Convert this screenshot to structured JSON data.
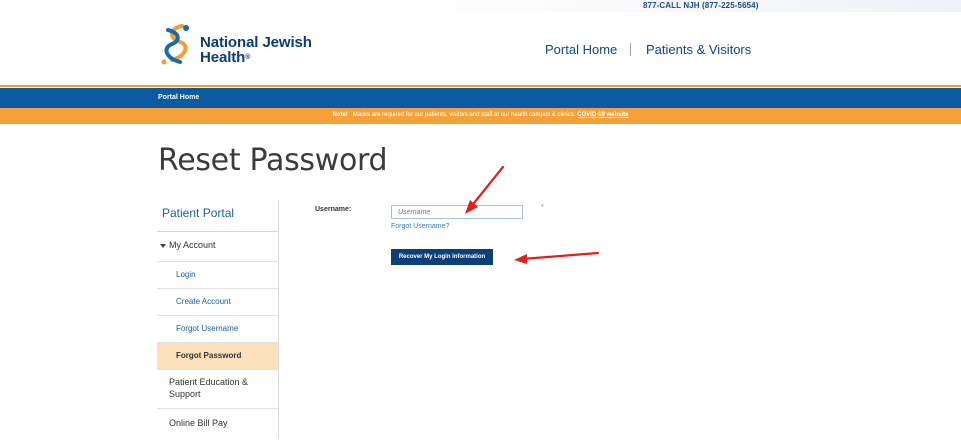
{
  "header": {
    "phone": "877-CALL NJH (877-225-5654)",
    "logo_line1": "National Jewish",
    "logo_line2": "Health",
    "logo_reg": "®",
    "nav": [
      {
        "label": "Portal Home"
      },
      {
        "label": "Patients & Visitors"
      }
    ]
  },
  "breadcrumb": "Portal Home",
  "notice": {
    "prefix": "Note!",
    "text": "Masks are required for our patients, visitors and staff at our health campus & clinics.",
    "link": "COVID-19 website"
  },
  "page_title": "Reset Password",
  "sidebar": {
    "heading": "Patient Portal",
    "my_account": "My Account",
    "sub_items": [
      {
        "label": "Login"
      },
      {
        "label": "Create Account"
      },
      {
        "label": "Forgot Username"
      },
      {
        "label": "Forgot Password"
      }
    ],
    "education": "Patient Education & Support",
    "bill_pay": "Online Bill Pay"
  },
  "form": {
    "username_label": "Username:",
    "username_placeholder": "Username",
    "required_mark": "*",
    "forgot_username": "Forgot Username?",
    "submit_label": "Recover My Login Information"
  },
  "colors": {
    "brand_blue": "#0c5aa2",
    "brand_orange": "#f5a13a",
    "button_navy": "#0b3f77",
    "active_highlight": "#fde0bd",
    "annotation_arrow": "#e0201b"
  }
}
